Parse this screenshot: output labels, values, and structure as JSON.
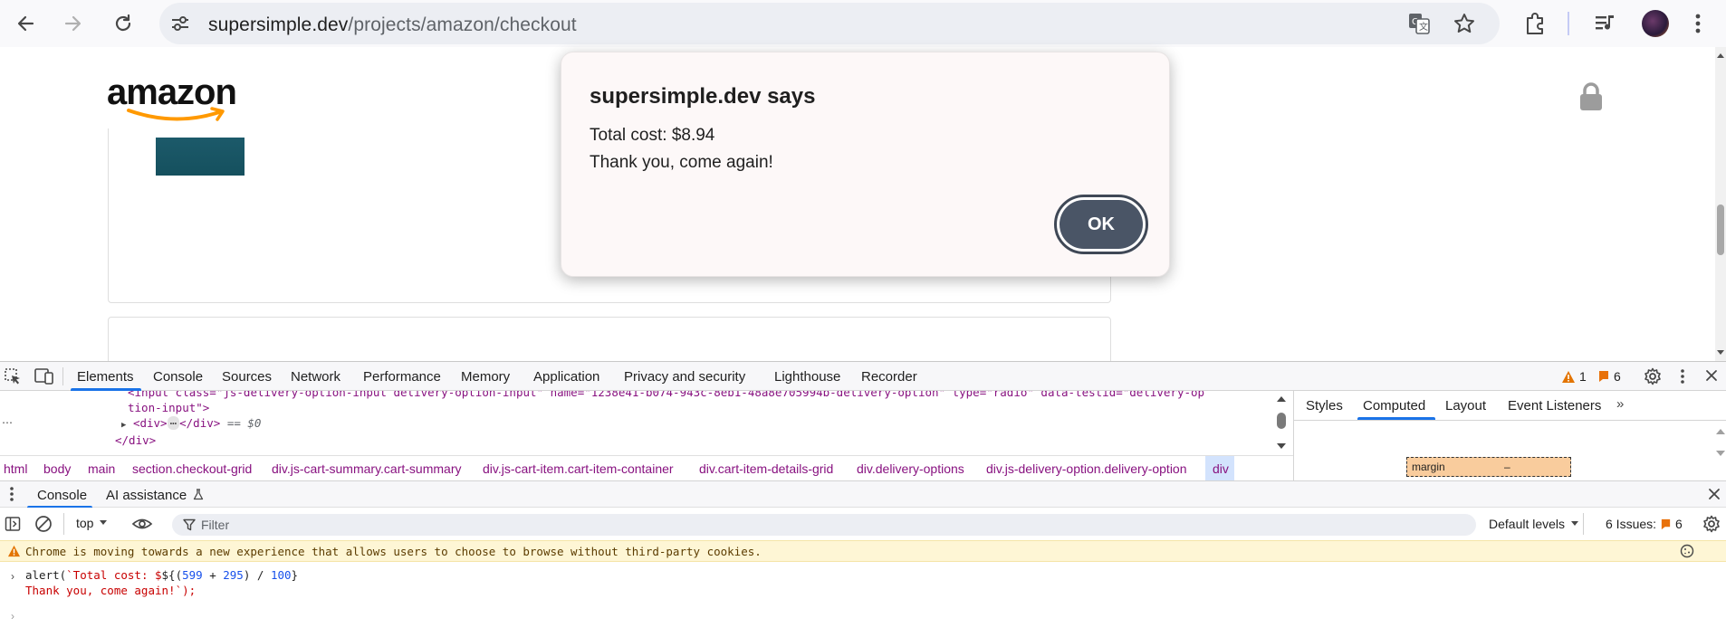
{
  "browser": {
    "url_domain": "supersimple.dev",
    "url_path": "/projects/amazon/checkout"
  },
  "page": {
    "logo_text": "amazon"
  },
  "dialog": {
    "title": "supersimple.dev says",
    "line1": "Total cost: $8.94",
    "line2": "Thank you, come again!",
    "ok_label": "OK"
  },
  "devtools": {
    "tabs": [
      "Elements",
      "Console",
      "Sources",
      "Network",
      "Performance",
      "Memory",
      "Application",
      "Privacy and security",
      "Lighthouse",
      "Recorder"
    ],
    "active_tab": "Elements",
    "warning_count": "1",
    "issue_count": "6",
    "elements": {
      "line1": "<input class=\"js-delivery-option-input delivery-option-input\" name=\"1238e41-b074-943c-8eb1-48a8e705994b-delivery-option\" type=\"radio\" data-testid=\"delivery-op",
      "line2": "tion-input\">",
      "line3_tag_open": "<div>",
      "line3_ellipsis": "⋯",
      "line3_tag_close": "</div>",
      "line3_suffix": "== $0",
      "line4": "</div>"
    },
    "breadcrumbs": [
      "html",
      "body",
      "main",
      "section.checkout-grid",
      "div.js-cart-summary.cart-summary",
      "div.js-cart-item.cart-item-container",
      "div.cart-item-details-grid",
      "div.delivery-options",
      "div.js-delivery-option.delivery-option",
      "div"
    ],
    "styles_tabs": [
      "Styles",
      "Computed",
      "Layout",
      "Event Listeners"
    ],
    "styles_active": "Computed",
    "margin_label": "margin",
    "margin_value": "–",
    "drawer_tabs": [
      "Console",
      "AI assistance"
    ],
    "drawer_active": "Console",
    "context": "top",
    "filter_placeholder": "Filter",
    "levels": "Default levels",
    "issues_label": "6 Issues:",
    "issues_count": "6",
    "warning_message": "Chrome is moving towards a new experience that allows users to choose to browse without third-party cookies.",
    "console_input_prefix": "alert(`Total cost: $${(",
    "console_num1": "599",
    "console_op": " + ",
    "console_num2": "295",
    "console_mid": ") / ",
    "console_num3": "100",
    "console_end": "}",
    "console_line2": "Thank you, come again!`);"
  },
  "colors": {
    "accent": "#1a73e8",
    "amazon_orange": "#ff9900",
    "dialog_button": "#4a5566",
    "warning_bg": "#fef6d5"
  }
}
